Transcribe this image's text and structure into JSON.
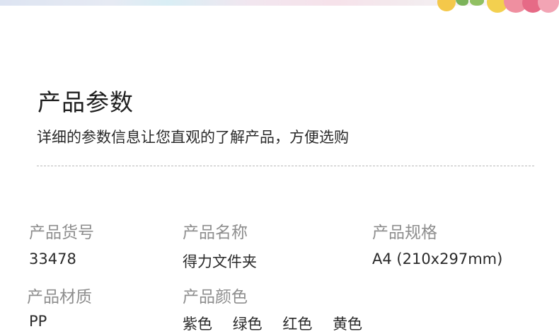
{
  "header": {
    "title": "产品参数",
    "subtitle": "详细的参数信息让您直观的了解产品，方便选购"
  },
  "params": {
    "item_no": {
      "label": "产品货号",
      "value": "33478"
    },
    "name": {
      "label": "产品名称",
      "value": "得力文件夹"
    },
    "spec": {
      "label": "产品规格",
      "value": "A4 (210x297mm)"
    },
    "material": {
      "label": "产品材质",
      "value": "PP"
    },
    "color": {
      "label": "产品颜色",
      "values": [
        "紫色",
        "绿色",
        "红色",
        "黄色"
      ]
    }
  },
  "theme": {
    "label_color": "#8e8e8e",
    "value_color": "#2a2a2a",
    "divider_color": "#b9b9b9"
  }
}
